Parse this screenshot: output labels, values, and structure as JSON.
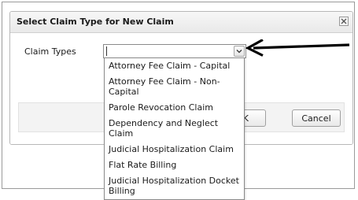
{
  "dialog": {
    "title": "Select Claim Type for New Claim",
    "close_label": "×",
    "field_label": "Claim Types",
    "select_value": "",
    "ok_label": "OK",
    "cancel_label": "Cancel"
  },
  "dropdown": {
    "options": [
      "Attorney Fee Claim - Capital",
      "Attorney Fee Claim - Non-Capital",
      "Parole Revocation Claim",
      "Dependency and Neglect Claim",
      "Judicial Hospitalization Claim",
      "Flat Rate Billing",
      "Judicial Hospitalization Docket Billing"
    ]
  },
  "annotation": {
    "icon": "arrow-left-icon",
    "color": "#000000"
  }
}
